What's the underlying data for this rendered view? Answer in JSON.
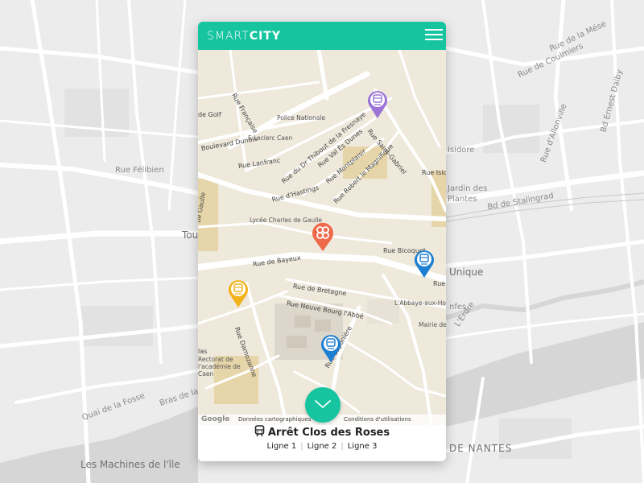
{
  "app": {
    "brand_light": "SMART",
    "brand_bold": "CITY",
    "accent_color": "#16c4a0"
  },
  "background_map": {
    "labels": [
      "Rue Félibien",
      "Tou",
      "Quai de la Fosse",
      "Bras de la Madeleine",
      "Les Machines de l'île",
      "Rue de Coulmiers",
      "Bd Ernest Dalby",
      "Rue de la Mése",
      "Rue d'Allonville",
      "Bd de Stalingrad",
      "Unique",
      "L'Erdre",
      "nfes",
      "DE NANTES",
      "Isidore",
      "Jardin des",
      "Plantes"
    ]
  },
  "map": {
    "streets": [
      "Boulevard Dunois",
      "Rue Lanfranc",
      "Rue du Dr Thibout de la Fresnaye",
      "Rue Val Ès Dunes",
      "Rue Montplaisir",
      "Rue Robert le Magnifique",
      "Rue Saint-Gabriel",
      "Rue d'Hastings",
      "Rue de Bayeux",
      "Rue de Bretagne",
      "Rue Neuve Bourg l'Abbé",
      "Rue Damozanne",
      "Rue Caponière",
      "Rue Bicoquet",
      "Rue Guill",
      "Rue Isido",
      "Rue Française",
      "de Gaulle",
      "de Golf",
      "las"
    ],
    "pois": [
      "Police Nationale",
      "E.Leclerc Caen",
      "Lycée Charles de Gaulle",
      "L'Abbaye-aux-Homm",
      "Mairie de Caen",
      "Rectorat de l'académie de Caen"
    ],
    "attribution": {
      "google": "Google",
      "data": "Données cartographiques",
      "terms": "Conditions d'utilisations"
    },
    "pins": [
      {
        "name": "tram-purple",
        "color": "#9b74d6",
        "icon": "tram-icon"
      },
      {
        "name": "selected-location",
        "color": "#ef6a4a",
        "icon": "clover-icon"
      },
      {
        "name": "tram-blue-east",
        "color": "#1c7fd1",
        "icon": "tram-icon"
      },
      {
        "name": "tram-yellow",
        "color": "#f1b21c",
        "icon": "tram-icon"
      },
      {
        "name": "tram-blue-south",
        "color": "#1c7fd1",
        "icon": "tram-icon"
      }
    ]
  },
  "stop": {
    "title": "Arrêt Clos des Roses",
    "lines": [
      "Ligne 1",
      "Ligne 2",
      "Ligne 3"
    ]
  }
}
